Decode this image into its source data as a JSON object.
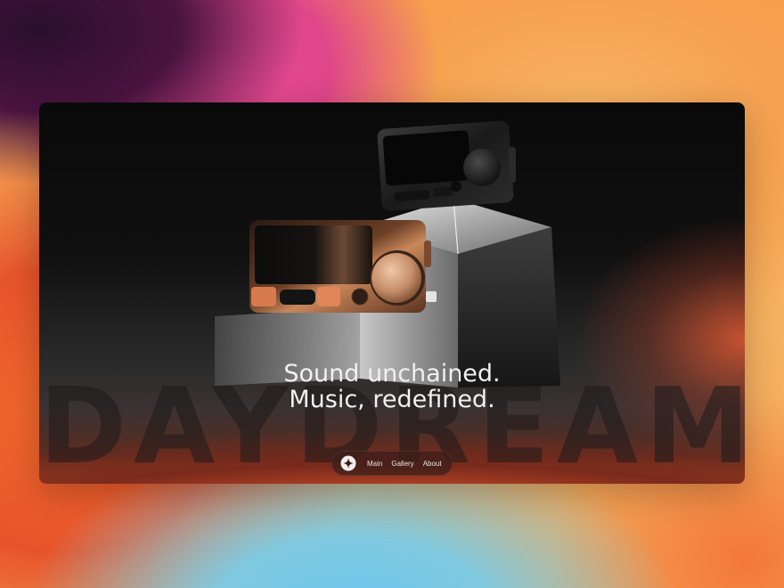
{
  "hero": {
    "watermark": "DAYDREAM",
    "headline_line1": "Sound unchained.",
    "headline_line2": "Music, redefined."
  },
  "nav": {
    "logo_icon": "sparkle-logo-icon",
    "items": [
      {
        "label": "Main"
      },
      {
        "label": "Gallery"
      },
      {
        "label": "About"
      }
    ]
  },
  "colors": {
    "accent_copper": "#d98a5e",
    "card_bg": "#0a0a0a",
    "text": "#f1f1f1"
  }
}
